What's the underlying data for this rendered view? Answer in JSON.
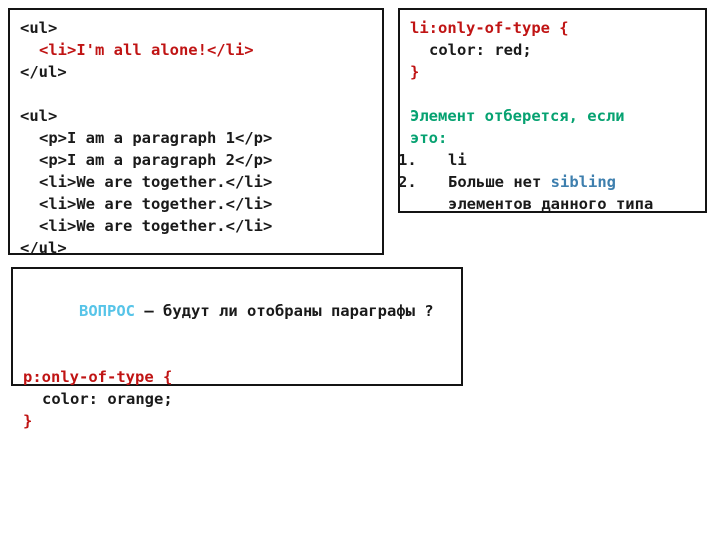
{
  "slide": {
    "background_color": "#ffffff",
    "topic": "CSS :only-of-type selector"
  },
  "colors": {
    "red": "#c01414",
    "black": "#1a1a1a",
    "green": "#06a271",
    "blue": "#3e7fae",
    "cyan": "#57c4e8",
    "border": "#141414"
  },
  "html_markup_box": {
    "lines": [
      {
        "indent": 0,
        "segments": [
          {
            "text": "<ul>",
            "color": "black"
          }
        ]
      },
      {
        "indent": 1,
        "segments": [
          {
            "text": "<li>I'm all alone!</li>",
            "color": "red"
          }
        ]
      },
      {
        "indent": 0,
        "segments": [
          {
            "text": "</ul>",
            "color": "black"
          }
        ]
      },
      {
        "indent": 0,
        "segments": [
          {
            "text": " ",
            "color": "black"
          }
        ]
      },
      {
        "indent": 0,
        "segments": [
          {
            "text": "<ul>",
            "color": "black"
          }
        ]
      },
      {
        "indent": 1,
        "segments": [
          {
            "text": "<p>I am a paragraph 1</p>",
            "color": "black"
          }
        ]
      },
      {
        "indent": 1,
        "segments": [
          {
            "text": "<p>I am a paragraph 2</p>",
            "color": "black"
          }
        ]
      },
      {
        "indent": 1,
        "segments": [
          {
            "text": "<li>We are together.</li>",
            "color": "black"
          }
        ]
      },
      {
        "indent": 1,
        "segments": [
          {
            "text": "<li>We are together.</li>",
            "color": "black"
          }
        ]
      },
      {
        "indent": 1,
        "segments": [
          {
            "text": "<li>We are together.</li>",
            "color": "black"
          }
        ]
      },
      {
        "indent": 0,
        "segments": [
          {
            "text": "</ul>",
            "color": "black"
          }
        ]
      }
    ]
  },
  "li_rule_box": {
    "rule_lines": [
      {
        "indent": 0,
        "segments": [
          {
            "text": "li:only-of-type {",
            "color": "red"
          }
        ]
      },
      {
        "indent": 1,
        "segments": [
          {
            "text": "color: red;",
            "color": "black"
          }
        ]
      },
      {
        "indent": 0,
        "segments": [
          {
            "text": "}",
            "color": "red"
          }
        ]
      },
      {
        "indent": 0,
        "segments": [
          {
            "text": " ",
            "color": "black"
          }
        ]
      }
    ],
    "explanation_heading_line1": "Элемент отберется, если",
    "explanation_heading_line2": "это:",
    "list": [
      {
        "marker": "1.",
        "parts": [
          {
            "text": "li",
            "color": "black"
          }
        ],
        "continuation": null
      },
      {
        "marker": "2.",
        "parts": [
          {
            "text": "Больше нет ",
            "color": "black"
          },
          {
            "text": "sibling",
            "color": "blue"
          }
        ],
        "continuation": "элементов данного типа"
      }
    ]
  },
  "question_box": {
    "question_label": "ВОПРОС",
    "question_text": " – будут ли отобраны параграфы ?",
    "rule_lines": [
      {
        "indent": 0,
        "segments": [
          {
            "text": " ",
            "color": "black"
          }
        ]
      },
      {
        "indent": 0,
        "segments": [
          {
            "text": "p:only-of-type {",
            "color": "red"
          }
        ]
      },
      {
        "indent": 1,
        "segments": [
          {
            "text": "color: orange;",
            "color": "black"
          }
        ]
      },
      {
        "indent": 0,
        "segments": [
          {
            "text": "}",
            "color": "red"
          }
        ]
      }
    ]
  }
}
